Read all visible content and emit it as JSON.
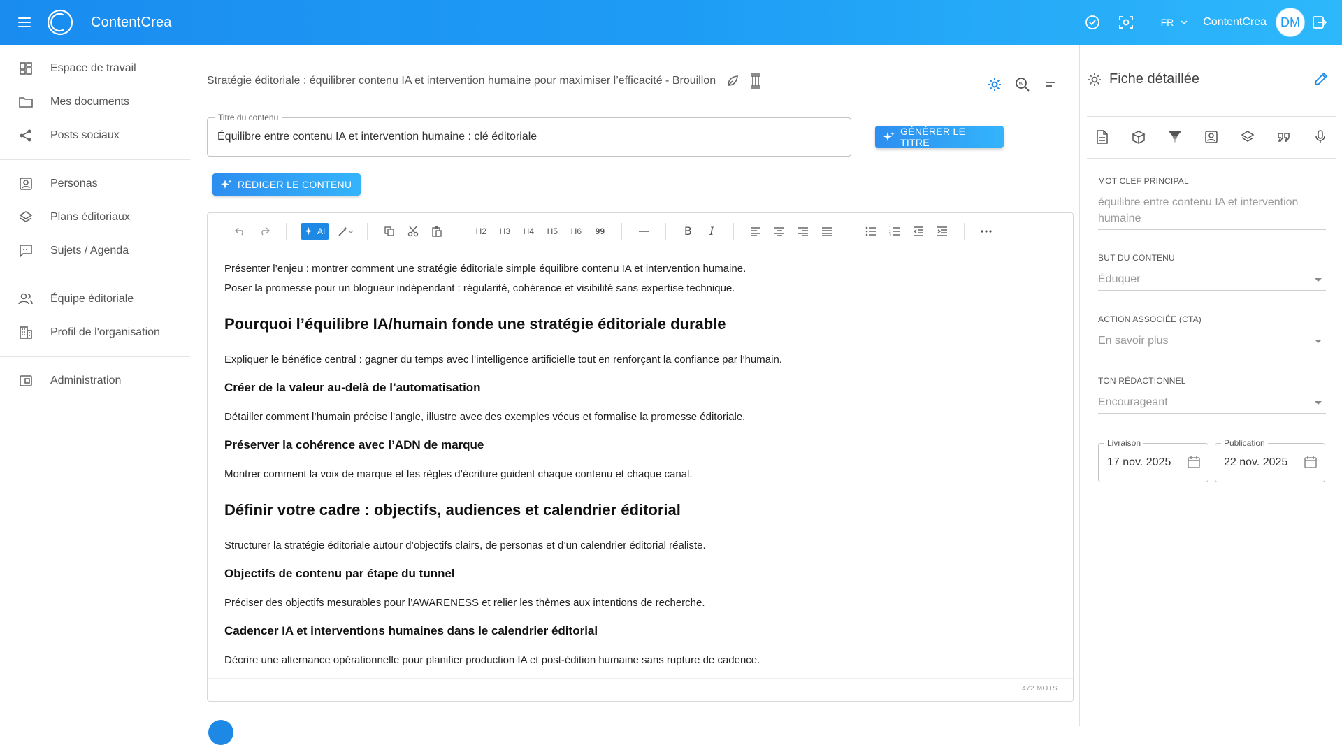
{
  "app": {
    "name": "ContentCrea",
    "language": "FR",
    "user_name": "ContentCrea",
    "user_initials": "DM"
  },
  "sidebar": {
    "groups": [
      [
        {
          "label": "Espace de travail",
          "icon": "dashboard-icon"
        },
        {
          "label": "Mes documents",
          "icon": "folder-icon"
        },
        {
          "label": "Posts sociaux",
          "icon": "share-icon"
        }
      ],
      [
        {
          "label": "Personas",
          "icon": "persona-icon"
        },
        {
          "label": "Plans éditoriaux",
          "icon": "layers-icon"
        },
        {
          "label": "Sujets / Agenda",
          "icon": "chat-icon"
        }
      ],
      [
        {
          "label": "Équipe éditoriale",
          "icon": "team-icon"
        },
        {
          "label": "Profil de l'organisation",
          "icon": "building-icon"
        }
      ],
      [
        {
          "label": "Administration",
          "icon": "admin-icon"
        }
      ]
    ]
  },
  "document": {
    "header": "Stratégie éditoriale : équilibrer contenu IA et intervention humaine pour maximiser l’efficacité - Brouillon",
    "title_label": "Titre du contenu",
    "title_value": "Équilibre entre contenu IA et intervention humaine : clé éditoriale",
    "generate_title_button": "GÉNÉRER LE TITRE",
    "write_content_button": "RÉDIGER LE CONTENU",
    "toolbar": {
      "ai_label": "AI",
      "headings": [
        "H2",
        "H3",
        "H4",
        "H5",
        "H6",
        "99"
      ]
    },
    "content": [
      {
        "type": "p",
        "text": "Présenter l’enjeu : montrer comment une stratégie éditoriale simple équilibre contenu IA et intervention humaine."
      },
      {
        "type": "p",
        "text": "Poser la promesse pour un blogueur indépendant : régularité, cohérence et visibilité sans expertise technique."
      },
      {
        "type": "h2",
        "text": "Pourquoi l’équilibre IA/humain fonde une stratégie éditoriale durable"
      },
      {
        "type": "p",
        "text": "Expliquer le bénéfice central : gagner du temps avec l’intelligence artificielle tout en renforçant la confiance par l’humain."
      },
      {
        "type": "h3",
        "text": "Créer de la valeur au-delà de l’automatisation"
      },
      {
        "type": "p",
        "text": "Détailler comment l’humain précise l’angle, illustre avec des exemples vécus et formalise la promesse éditoriale."
      },
      {
        "type": "h3",
        "text": "Préserver la cohérence avec l’ADN de marque"
      },
      {
        "type": "p",
        "text": "Montrer comment la voix de marque et les règles d’écriture guident chaque contenu et chaque canal."
      },
      {
        "type": "h2",
        "text": "Définir votre cadre : objectifs, audiences et calendrier éditorial"
      },
      {
        "type": "p",
        "text": "Structurer la stratégie éditoriale autour d’objectifs clairs, de personas et d’un calendrier éditorial réaliste."
      },
      {
        "type": "h3",
        "text": "Objectifs de contenu par étape du tunnel"
      },
      {
        "type": "p",
        "text": "Préciser des objectifs mesurables pour l’AWARENESS et relier les thèmes aux intentions de recherche."
      },
      {
        "type": "h3",
        "text": "Cadencer IA et interventions humaines dans le calendrier éditorial"
      },
      {
        "type": "p",
        "text": "Décrire une alternance opérationnelle pour planifier production IA et post-édition humaine sans rupture de cadence."
      }
    ],
    "word_count": "472 MOTS"
  },
  "detail_panel": {
    "title": "Fiche détaillée",
    "fields": {
      "keyword_label": "MOT CLEF PRINCIPAL",
      "keyword_value": "équilibre entre contenu IA et intervention humaine",
      "goal_label": "BUT DU CONTENU",
      "goal_value": "Éduquer",
      "cta_label": "ACTION ASSOCIÉE (CTA)",
      "cta_value": "En savoir plus",
      "tone_label": "TON RÉDACTIONNEL",
      "tone_value": "Encourageant",
      "delivery_label": "Livraison",
      "delivery_value": "17 nov. 2025",
      "publication_label": "Publication",
      "publication_value": "22 nov. 2025"
    }
  },
  "colors": {
    "brand_gradient_start": "#1a8cf0",
    "brand_gradient_end": "#2db8fb",
    "accent": "#1e88e5"
  }
}
